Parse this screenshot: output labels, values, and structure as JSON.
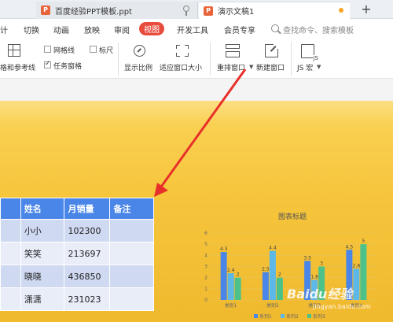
{
  "tabs": [
    {
      "label": "百度经验PPT模板.ppt",
      "icon": "ppt-icon"
    },
    {
      "label": "演示文稿1",
      "icon": "ppt-icon"
    }
  ],
  "add_tab": "+",
  "menu": {
    "items": [
      "计",
      "切换",
      "动画",
      "放映",
      "审阅",
      "视图",
      "开发工具",
      "会员专享"
    ],
    "active": "视图",
    "search_placeholder": "查找命令、搜索模板"
  },
  "toolbar": {
    "guides_label": "格和参考线",
    "gridlines_label": "网格线",
    "ruler_label": "标尺",
    "taskpane_label": "任务窗格",
    "zoom_label": "显示比例",
    "fit_label": "适应窗口大小",
    "arrange_label": "重排窗口",
    "new_window_label": "新建窗口",
    "macro_label": "JS 宏",
    "taskpane_checked": true,
    "gridlines_checked": false,
    "ruler_checked": false
  },
  "table": {
    "headers": [
      "",
      "姓名",
      "月销量",
      "备注"
    ],
    "rows": [
      [
        "",
        "小小",
        "102300",
        ""
      ],
      [
        "",
        "笑笑",
        "213697",
        ""
      ],
      [
        "",
        "晓晓",
        "436850",
        ""
      ],
      [
        "",
        "潇潇",
        "231023",
        ""
      ]
    ]
  },
  "chart_data": {
    "type": "bar",
    "title": "图表标题",
    "categories": [
      "类别1",
      "类别2",
      "类别3",
      "类别4"
    ],
    "series": [
      {
        "name": "系列1",
        "values": [
          4.3,
          2.5,
          3.5,
          4.5
        ],
        "color": "#4a86e8"
      },
      {
        "name": "系列2",
        "values": [
          2.4,
          4.4,
          1.8,
          2.8
        ],
        "color": "#5bb8e8"
      },
      {
        "name": "系列3",
        "values": [
          2,
          2,
          3,
          5
        ],
        "color": "#4cc28a"
      }
    ],
    "ylim": [
      0,
      6
    ],
    "yticks": [
      0,
      1,
      2,
      3,
      4,
      5,
      6
    ],
    "grid": true,
    "legend": "bottom"
  },
  "watermark": {
    "brand": "Baidu经验",
    "url": "jingyan.baidu.com"
  },
  "colors": {
    "accent": "#e84c3d",
    "slide_bg": "#f6c63d",
    "table_header": "#4a86e8",
    "arrow": "#e8302a"
  }
}
